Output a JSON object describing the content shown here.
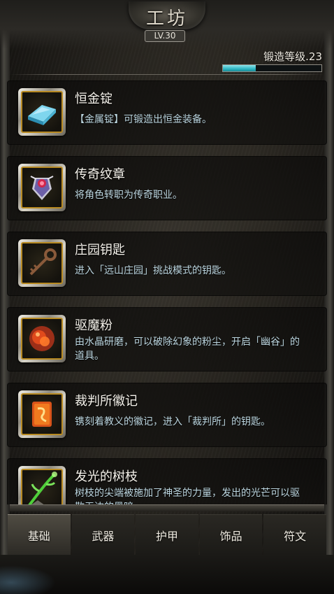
{
  "header": {
    "title": "工坊",
    "level": "LV.30"
  },
  "forge": {
    "label": "锻造等级.23",
    "progress": 0.33
  },
  "items": [
    {
      "name": "恒金锭",
      "desc": "【金属锭】可锻造出恒金装备。",
      "icon": "ingot-icon"
    },
    {
      "name": "传奇纹章",
      "desc": "将角色转职为传奇职业。",
      "icon": "emblem-icon"
    },
    {
      "name": "庄园钥匙",
      "desc": "进入「远山庄园」挑战模式的钥匙。",
      "icon": "key-icon"
    },
    {
      "name": "驱魔粉",
      "desc": "由水晶研磨，可以破除幻象的粉尘，开启「幽谷」的道具。",
      "icon": "powder-icon"
    },
    {
      "name": "裁判所徽记",
      "desc": "镌刻着教义的徽记，进入「裁判所」的钥匙。",
      "icon": "insignia-icon"
    },
    {
      "name": "发光的树枝",
      "desc": "树枝的尖端被施加了神圣的力量，发出的光芒可以驱散无边的黑暗。",
      "icon": "branch-icon"
    }
  ],
  "tabs": [
    {
      "label": "基础",
      "active": true
    },
    {
      "label": "武器",
      "active": false
    },
    {
      "label": "护甲",
      "active": false
    },
    {
      "label": "饰品",
      "active": false
    },
    {
      "label": "符文",
      "active": false
    }
  ],
  "colors": {
    "accent": "#2fb7c4",
    "desc_text": "#bcd6e0",
    "icon_border": "#b88a22"
  }
}
